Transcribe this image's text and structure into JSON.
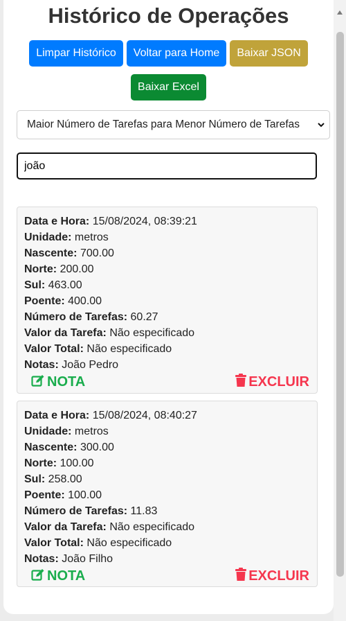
{
  "page": {
    "title": "Histórico de Operações"
  },
  "buttons": {
    "clear": "Limpar Histórico",
    "home": "Voltar para Home",
    "json": "Baixar JSON",
    "excel": "Baixar Excel"
  },
  "sort": {
    "selected": "Maior Número de Tarefas para Menor Número de Tarefas"
  },
  "search": {
    "value": "joão"
  },
  "labels": {
    "date": "Data e Hora:",
    "unit": "Unidade:",
    "east": "Nascente:",
    "north": "Norte:",
    "south": "Sul:",
    "west": "Poente:",
    "tasks": "Número de Tarefas:",
    "task_value": "Valor da Tarefa:",
    "total": "Valor Total:",
    "notes": "Notas:",
    "note_action": "NOTA",
    "delete_action": "EXCLUIR"
  },
  "records": [
    {
      "date": "15/08/2024, 08:39:21",
      "unit": "metros",
      "east": "700.00",
      "north": "200.00",
      "south": "463.00",
      "west": "400.00",
      "tasks": "60.27",
      "task_value": "Não especificado",
      "total": "Não especificado",
      "notes": "João Pedro"
    },
    {
      "date": "15/08/2024, 08:40:27",
      "unit": "metros",
      "east": "300.00",
      "north": "100.00",
      "south": "258.00",
      "west": "100.00",
      "tasks": "11.83",
      "task_value": "Não especificado",
      "total": "Não especificado",
      "notes": "João Filho"
    }
  ],
  "icons": {
    "note": "edit-icon",
    "delete": "trash-icon"
  },
  "colors": {
    "primary_blue": "#007bff",
    "gold": "#c0a33a",
    "green": "#0b8a32",
    "note_green": "#1aad4d",
    "delete_red": "#f5364e"
  }
}
